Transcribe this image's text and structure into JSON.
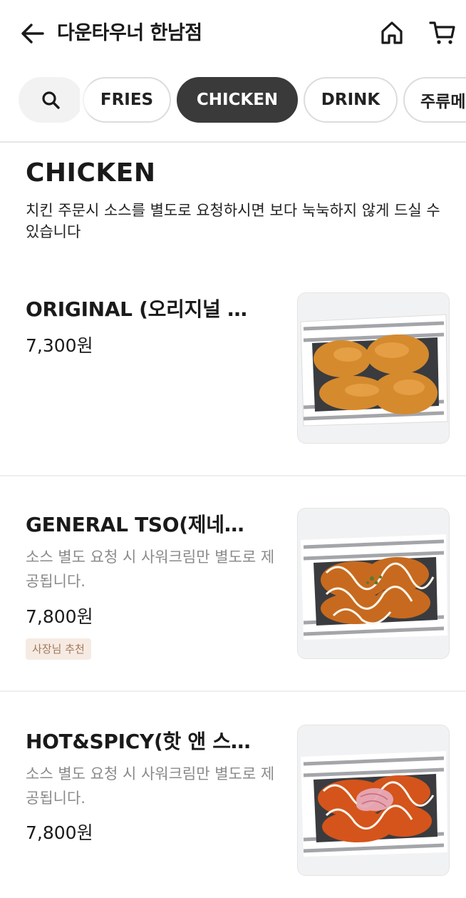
{
  "header": {
    "back_icon": "arrow-left-icon",
    "title": "다운타우너 한남점",
    "home_icon": "home-icon",
    "cart_icon": "cart-icon"
  },
  "tabs": {
    "search_icon": "search-icon",
    "items": [
      {
        "label": "FRIES",
        "active": false
      },
      {
        "label": "CHICKEN",
        "active": true
      },
      {
        "label": "DRINK",
        "active": false
      },
      {
        "label": "주류메뉴",
        "active": false
      }
    ]
  },
  "section": {
    "title": "CHICKEN",
    "description": "치킨 주문시 소스를 별도로 요청하시면 보다 눅눅하지 않게 드실 수 있습니다"
  },
  "menu_items": [
    {
      "name": "ORIGINAL (오리지널 치킨)",
      "description": "",
      "price": "7,300원",
      "badge": "",
      "image_icon": "fried-chicken-image"
    },
    {
      "name": "GENERAL TSO(제네럴 쏘)",
      "description": "소스 별도 요청 시 사워크림만 별도로 제공됩니다.",
      "price": "7,800원",
      "badge": "사장님 추천",
      "image_icon": "general-tso-chicken-image"
    },
    {
      "name": "HOT&SPICY(핫 앤 스파이시)",
      "description": "소스 별도 요청 시 사워크림만 별도로 제공됩니다.",
      "price": "7,800원",
      "badge": "",
      "image_icon": "hot-spicy-chicken-image"
    }
  ],
  "colors": {
    "active_tab": "#3a3a3a",
    "badge_bg": "#f6ebe3",
    "badge_text": "#a2775a",
    "muted_text": "#8a8a8a"
  }
}
